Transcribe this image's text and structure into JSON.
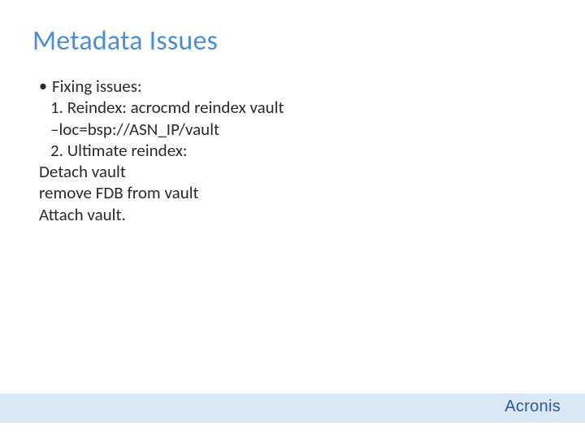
{
  "slide": {
    "title": "Metadata Issues",
    "bullet_lead": "Fixing issues:",
    "line_reindex": "1. Reindex: acrocmd reindex vault",
    "line_loc": "–loc=bsp://ASN_IP/vault",
    "line_ultimate": "2. Ultimate reindex:",
    "line_detach": "Detach vault",
    "line_remove": "remove FDB from vault",
    "line_attach": "Attach vault."
  },
  "brand": "Acronis"
}
